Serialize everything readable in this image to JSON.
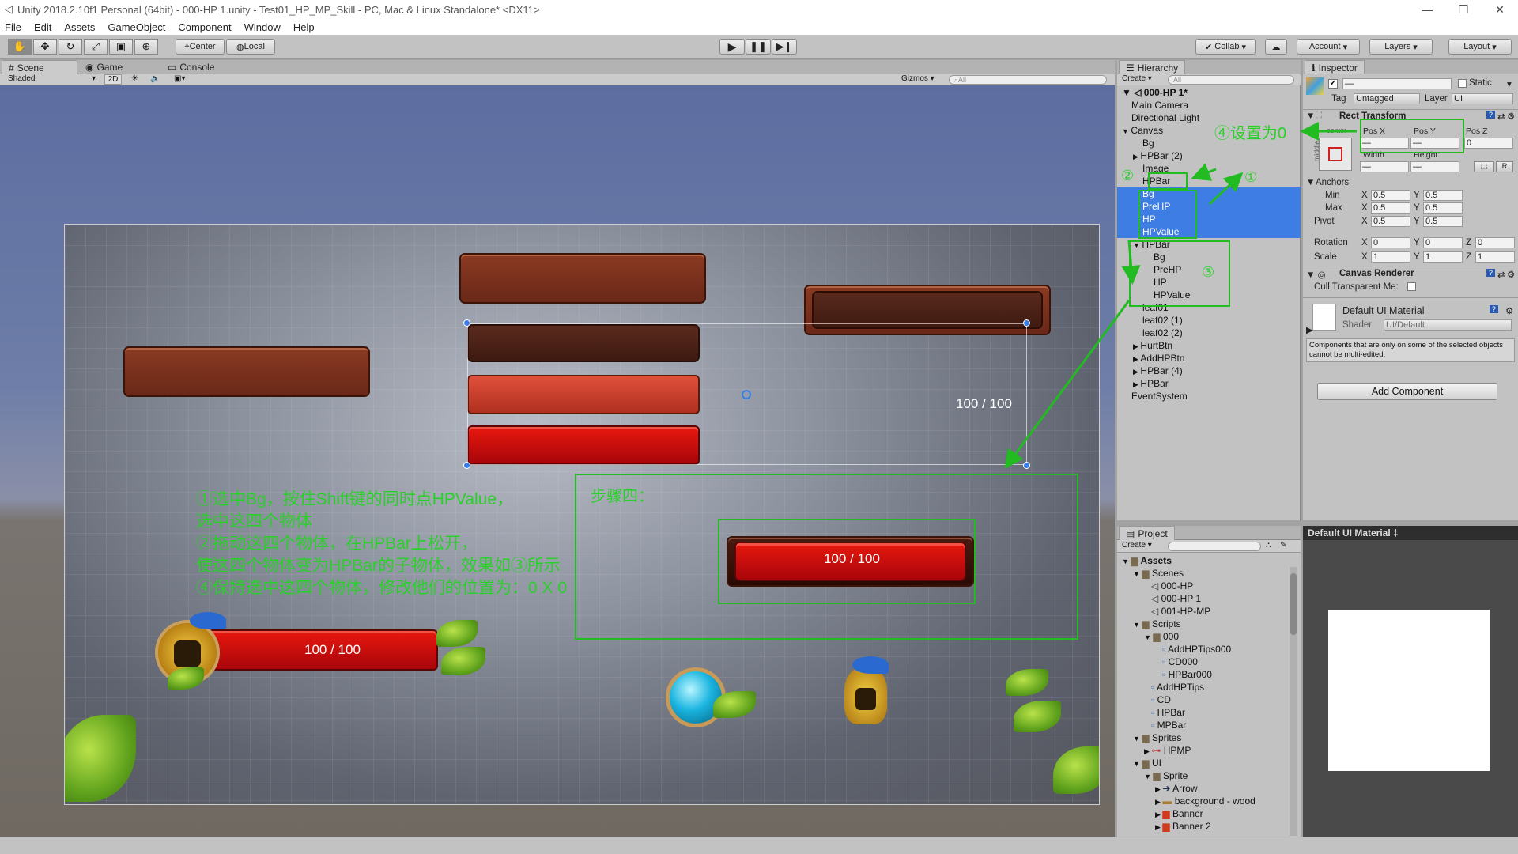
{
  "window": {
    "title": "Unity 2018.2.10f1 Personal (64bit) - 000-HP 1.unity - Test01_HP_MP_Skill - PC, Mac & Linux Standalone* <DX11>",
    "controls": [
      "—",
      "❐",
      "✕"
    ]
  },
  "menu": [
    "File",
    "Edit",
    "Assets",
    "GameObject",
    "Component",
    "Window",
    "Help"
  ],
  "toolbar": {
    "pivot": "Center",
    "space": "Local",
    "collab": "Collab",
    "account": "Account",
    "layers": "Layers",
    "layout": "Layout"
  },
  "scene_tabs": {
    "scene": "Scene",
    "game": "Game",
    "console": "Console"
  },
  "scene_bar": {
    "shading": "Shaded",
    "mode2d": "2D",
    "gizmos": "Gizmos",
    "search_placeholder": "All"
  },
  "game": {
    "bar_text_right": "100 / 100",
    "bar_text_step": "100 / 100",
    "bar_text_bottom": "100 / 100",
    "step_title": "步骤四：",
    "instructions": [
      "①选中Bg，按住Shift键的同时点HPValue，",
      "选中这四个物体",
      "②拖动这四个物体，在HPBar上松开，",
      "使这四个物体变为HPBar的子物体，效果如③所示",
      "④保持选中这四个物体，修改他们的位置为：0 X 0"
    ],
    "mark1": "①",
    "mark2": "②",
    "mark3": "③",
    "mark4": "④设置为0"
  },
  "hierarchy": {
    "tab": "Hierarchy",
    "create": "Create",
    "search_placeholder": "All",
    "scene": "000-HP 1*",
    "items": [
      {
        "label": "Main Camera",
        "indent": 0
      },
      {
        "label": "Directional Light",
        "indent": 0
      },
      {
        "label": "Canvas",
        "indent": 0,
        "arrow": "▼"
      },
      {
        "label": "Bg",
        "indent": 1
      },
      {
        "label": "HPBar (2)",
        "indent": 1,
        "arrow": "▶"
      },
      {
        "label": "Image",
        "indent": 1
      },
      {
        "label": "HPBar",
        "indent": 1
      },
      {
        "label": "Bg",
        "indent": 1,
        "selected": true
      },
      {
        "label": "PreHP",
        "indent": 1,
        "selected": true
      },
      {
        "label": "HP",
        "indent": 1,
        "selected": true
      },
      {
        "label": "HPValue",
        "indent": 1,
        "selected": true
      },
      {
        "label": "HPBar",
        "indent": 1,
        "arrow": "▼"
      },
      {
        "label": "Bg",
        "indent": 2
      },
      {
        "label": "PreHP",
        "indent": 2
      },
      {
        "label": "HP",
        "indent": 2
      },
      {
        "label": "HPValue",
        "indent": 2
      },
      {
        "label": "leaf01",
        "indent": 1
      },
      {
        "label": "leaf02 (1)",
        "indent": 1
      },
      {
        "label": "leaf02 (2)",
        "indent": 1
      },
      {
        "label": "HurtBtn",
        "indent": 1,
        "arrow": "▶"
      },
      {
        "label": "AddHPBtn",
        "indent": 1,
        "arrow": "▶"
      },
      {
        "label": "HPBar (4)",
        "indent": 1,
        "arrow": "▶"
      },
      {
        "label": "HPBar",
        "indent": 1,
        "arrow": "▶"
      },
      {
        "label": "EventSystem",
        "indent": 0
      }
    ]
  },
  "inspector": {
    "tab": "Inspector",
    "name_value": "—",
    "static_label": "Static",
    "tag_label": "Tag",
    "tag_value": "Untagged",
    "layer_label": "Layer",
    "layer_value": "UI",
    "rect_transform": "Rect Transform",
    "anchor_preset_h": "center",
    "anchor_preset_v": "middle",
    "pos_x_label": "Pos X",
    "pos_y_label": "Pos Y",
    "pos_z_label": "Pos Z",
    "pos_x": "—",
    "pos_y": "—",
    "pos_z": "0",
    "width_label": "Width",
    "height_label": "Height",
    "width": "—",
    "height": "—",
    "anchors": "Anchors",
    "min_label": "Min",
    "max_label": "Max",
    "pivot_label": "Pivot",
    "min_x": "0.5",
    "min_y": "0.5",
    "max_x": "0.5",
    "max_y": "0.5",
    "pivot_x": "0.5",
    "pivot_y": "0.5",
    "rotation_label": "Rotation",
    "scale_label": "Scale",
    "rot_x": "0",
    "rot_y": "0",
    "rot_z": "0",
    "scale_x": "1",
    "scale_y": "1",
    "scale_z": "1",
    "canvas_renderer": "Canvas Renderer",
    "cull_label": "Cull Transparent Me:",
    "material": "Default UI Material",
    "shader_label": "Shader",
    "shader_value": "UI/Default",
    "note": "Components that are only on some of the selected objects cannot be multi-edited.",
    "add_component": "Add Component",
    "axis_x": "X",
    "axis_y": "Y",
    "axis_z": "Z",
    "btn_r": "R"
  },
  "project": {
    "tab": "Project",
    "create": "Create",
    "items": [
      {
        "label": "Assets",
        "indent": 0,
        "arrow": "▼",
        "type": "folder",
        "bold": true
      },
      {
        "label": "Scenes",
        "indent": 1,
        "arrow": "▼",
        "type": "folder"
      },
      {
        "label": "000-HP",
        "indent": 2,
        "type": "scene"
      },
      {
        "label": "000-HP 1",
        "indent": 2,
        "type": "scene"
      },
      {
        "label": "001-HP-MP",
        "indent": 2,
        "type": "scene"
      },
      {
        "label": "Scripts",
        "indent": 1,
        "arrow": "▼",
        "type": "folder"
      },
      {
        "label": "000",
        "indent": 2,
        "arrow": "▼",
        "type": "folder"
      },
      {
        "label": "AddHPTips000",
        "indent": 3,
        "type": "script"
      },
      {
        "label": "CD000",
        "indent": 3,
        "type": "script"
      },
      {
        "label": "HPBar000",
        "indent": 3,
        "type": "script"
      },
      {
        "label": "AddHPTips",
        "indent": 2,
        "type": "script"
      },
      {
        "label": "CD",
        "indent": 2,
        "type": "script"
      },
      {
        "label": "HPBar",
        "indent": 2,
        "type": "script"
      },
      {
        "label": "MPBar",
        "indent": 2,
        "type": "script"
      },
      {
        "label": "Sprites",
        "indent": 1,
        "arrow": "▼",
        "type": "folder"
      },
      {
        "label": "HPMP",
        "indent": 2,
        "arrow": "▶",
        "type": "sprite"
      },
      {
        "label": "UI",
        "indent": 1,
        "arrow": "▼",
        "type": "folder"
      },
      {
        "label": "Sprite",
        "indent": 2,
        "arrow": "▼",
        "type": "folder"
      },
      {
        "label": "Arrow",
        "indent": 3,
        "arrow": "▶",
        "type": "arrow"
      },
      {
        "label": "background - wood",
        "indent": 3,
        "arrow": "▶",
        "type": "wood"
      },
      {
        "label": "Banner",
        "indent": 3,
        "arrow": "▶",
        "type": "banner"
      },
      {
        "label": "Banner 2",
        "indent": 3,
        "arrow": "▶",
        "type": "banner"
      }
    ]
  },
  "preview": {
    "title": "Default UI Material ‡"
  },
  "colors": {
    "selection": "#3e7de4",
    "annotation_green": "#22bb22",
    "hp_red": "#d0100c"
  }
}
